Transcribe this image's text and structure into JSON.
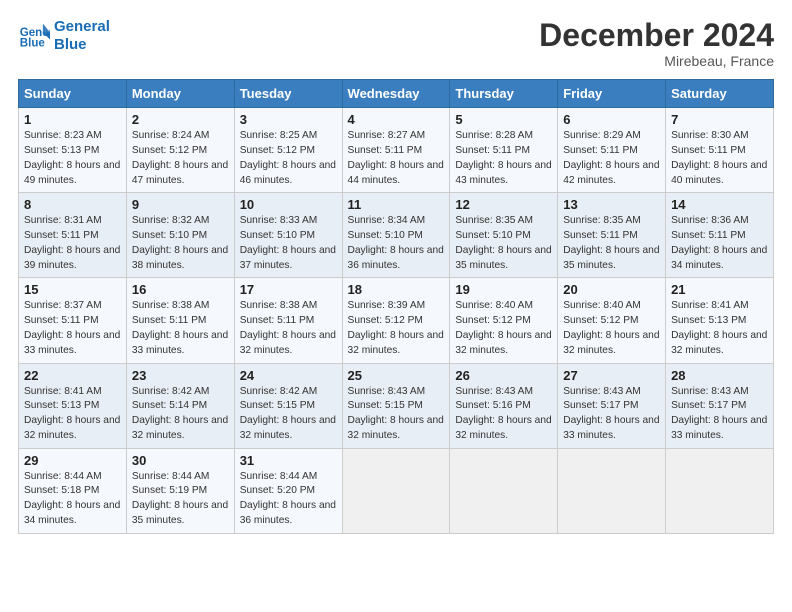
{
  "header": {
    "logo_line1": "General",
    "logo_line2": "Blue",
    "month": "December 2024",
    "location": "Mirebeau, France"
  },
  "days_of_week": [
    "Sunday",
    "Monday",
    "Tuesday",
    "Wednesday",
    "Thursday",
    "Friday",
    "Saturday"
  ],
  "weeks": [
    [
      {
        "day": "1",
        "sunrise": "Sunrise: 8:23 AM",
        "sunset": "Sunset: 5:13 PM",
        "daylight": "Daylight: 8 hours and 49 minutes."
      },
      {
        "day": "2",
        "sunrise": "Sunrise: 8:24 AM",
        "sunset": "Sunset: 5:12 PM",
        "daylight": "Daylight: 8 hours and 47 minutes."
      },
      {
        "day": "3",
        "sunrise": "Sunrise: 8:25 AM",
        "sunset": "Sunset: 5:12 PM",
        "daylight": "Daylight: 8 hours and 46 minutes."
      },
      {
        "day": "4",
        "sunrise": "Sunrise: 8:27 AM",
        "sunset": "Sunset: 5:11 PM",
        "daylight": "Daylight: 8 hours and 44 minutes."
      },
      {
        "day": "5",
        "sunrise": "Sunrise: 8:28 AM",
        "sunset": "Sunset: 5:11 PM",
        "daylight": "Daylight: 8 hours and 43 minutes."
      },
      {
        "day": "6",
        "sunrise": "Sunrise: 8:29 AM",
        "sunset": "Sunset: 5:11 PM",
        "daylight": "Daylight: 8 hours and 42 minutes."
      },
      {
        "day": "7",
        "sunrise": "Sunrise: 8:30 AM",
        "sunset": "Sunset: 5:11 PM",
        "daylight": "Daylight: 8 hours and 40 minutes."
      }
    ],
    [
      {
        "day": "8",
        "sunrise": "Sunrise: 8:31 AM",
        "sunset": "Sunset: 5:11 PM",
        "daylight": "Daylight: 8 hours and 39 minutes."
      },
      {
        "day": "9",
        "sunrise": "Sunrise: 8:32 AM",
        "sunset": "Sunset: 5:10 PM",
        "daylight": "Daylight: 8 hours and 38 minutes."
      },
      {
        "day": "10",
        "sunrise": "Sunrise: 8:33 AM",
        "sunset": "Sunset: 5:10 PM",
        "daylight": "Daylight: 8 hours and 37 minutes."
      },
      {
        "day": "11",
        "sunrise": "Sunrise: 8:34 AM",
        "sunset": "Sunset: 5:10 PM",
        "daylight": "Daylight: 8 hours and 36 minutes."
      },
      {
        "day": "12",
        "sunrise": "Sunrise: 8:35 AM",
        "sunset": "Sunset: 5:10 PM",
        "daylight": "Daylight: 8 hours and 35 minutes."
      },
      {
        "day": "13",
        "sunrise": "Sunrise: 8:35 AM",
        "sunset": "Sunset: 5:11 PM",
        "daylight": "Daylight: 8 hours and 35 minutes."
      },
      {
        "day": "14",
        "sunrise": "Sunrise: 8:36 AM",
        "sunset": "Sunset: 5:11 PM",
        "daylight": "Daylight: 8 hours and 34 minutes."
      }
    ],
    [
      {
        "day": "15",
        "sunrise": "Sunrise: 8:37 AM",
        "sunset": "Sunset: 5:11 PM",
        "daylight": "Daylight: 8 hours and 33 minutes."
      },
      {
        "day": "16",
        "sunrise": "Sunrise: 8:38 AM",
        "sunset": "Sunset: 5:11 PM",
        "daylight": "Daylight: 8 hours and 33 minutes."
      },
      {
        "day": "17",
        "sunrise": "Sunrise: 8:38 AM",
        "sunset": "Sunset: 5:11 PM",
        "daylight": "Daylight: 8 hours and 32 minutes."
      },
      {
        "day": "18",
        "sunrise": "Sunrise: 8:39 AM",
        "sunset": "Sunset: 5:12 PM",
        "daylight": "Daylight: 8 hours and 32 minutes."
      },
      {
        "day": "19",
        "sunrise": "Sunrise: 8:40 AM",
        "sunset": "Sunset: 5:12 PM",
        "daylight": "Daylight: 8 hours and 32 minutes."
      },
      {
        "day": "20",
        "sunrise": "Sunrise: 8:40 AM",
        "sunset": "Sunset: 5:12 PM",
        "daylight": "Daylight: 8 hours and 32 minutes."
      },
      {
        "day": "21",
        "sunrise": "Sunrise: 8:41 AM",
        "sunset": "Sunset: 5:13 PM",
        "daylight": "Daylight: 8 hours and 32 minutes."
      }
    ],
    [
      {
        "day": "22",
        "sunrise": "Sunrise: 8:41 AM",
        "sunset": "Sunset: 5:13 PM",
        "daylight": "Daylight: 8 hours and 32 minutes."
      },
      {
        "day": "23",
        "sunrise": "Sunrise: 8:42 AM",
        "sunset": "Sunset: 5:14 PM",
        "daylight": "Daylight: 8 hours and 32 minutes."
      },
      {
        "day": "24",
        "sunrise": "Sunrise: 8:42 AM",
        "sunset": "Sunset: 5:15 PM",
        "daylight": "Daylight: 8 hours and 32 minutes."
      },
      {
        "day": "25",
        "sunrise": "Sunrise: 8:43 AM",
        "sunset": "Sunset: 5:15 PM",
        "daylight": "Daylight: 8 hours and 32 minutes."
      },
      {
        "day": "26",
        "sunrise": "Sunrise: 8:43 AM",
        "sunset": "Sunset: 5:16 PM",
        "daylight": "Daylight: 8 hours and 32 minutes."
      },
      {
        "day": "27",
        "sunrise": "Sunrise: 8:43 AM",
        "sunset": "Sunset: 5:17 PM",
        "daylight": "Daylight: 8 hours and 33 minutes."
      },
      {
        "day": "28",
        "sunrise": "Sunrise: 8:43 AM",
        "sunset": "Sunset: 5:17 PM",
        "daylight": "Daylight: 8 hours and 33 minutes."
      }
    ],
    [
      {
        "day": "29",
        "sunrise": "Sunrise: 8:44 AM",
        "sunset": "Sunset: 5:18 PM",
        "daylight": "Daylight: 8 hours and 34 minutes."
      },
      {
        "day": "30",
        "sunrise": "Sunrise: 8:44 AM",
        "sunset": "Sunset: 5:19 PM",
        "daylight": "Daylight: 8 hours and 35 minutes."
      },
      {
        "day": "31",
        "sunrise": "Sunrise: 8:44 AM",
        "sunset": "Sunset: 5:20 PM",
        "daylight": "Daylight: 8 hours and 36 minutes."
      },
      null,
      null,
      null,
      null
    ]
  ]
}
